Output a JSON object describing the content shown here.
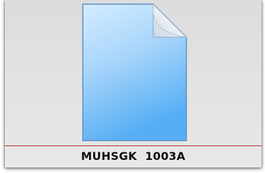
{
  "file_tile": {
    "icon": "blank-document-icon",
    "label": "MUHSGK  1003A",
    "colors": {
      "tile_background": "#e0e0e0",
      "divider": "#b22a2a",
      "document_light": "#d4ecff",
      "document_dark": "#57aef5"
    }
  }
}
